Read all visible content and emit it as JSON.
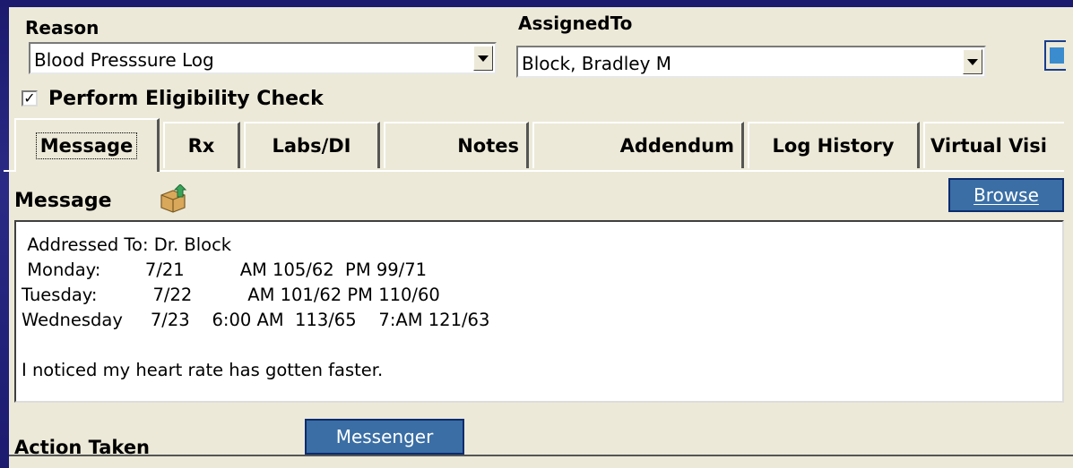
{
  "reason": {
    "label": "Reason",
    "value": "Blood Presssure Log"
  },
  "assigned_to": {
    "label": "AssignedTo",
    "value": "Block, Bradley M"
  },
  "eligibility": {
    "label": "Perform Eligibility Check",
    "checked": true,
    "mark": "✓"
  },
  "tabs": [
    {
      "label": "Message"
    },
    {
      "label": "Rx"
    },
    {
      "label": "Labs/DI"
    },
    {
      "label": "Notes"
    },
    {
      "label": "Addendum"
    },
    {
      "label": "Log History"
    },
    {
      "label": "Virtual Visi"
    }
  ],
  "message": {
    "title": "Message",
    "browse_label": "Browse",
    "body": " Addressed To: Dr. Block\n Monday:        7/21          AM 105/62  PM 99/71\nTuesday:          7/22          AM 101/62 PM 110/60\nWednesday     7/23    6:00 AM  113/65    7:AM 121/63\n\nI noticed my heart rate has gotten faster."
  },
  "action": {
    "label": "Action Taken",
    "messenger_label": "Messenger"
  },
  "colors": {
    "window_bg": "#ece9d8",
    "button_blue": "#3a6ea5",
    "frame_bg": "#1b1a6e"
  }
}
